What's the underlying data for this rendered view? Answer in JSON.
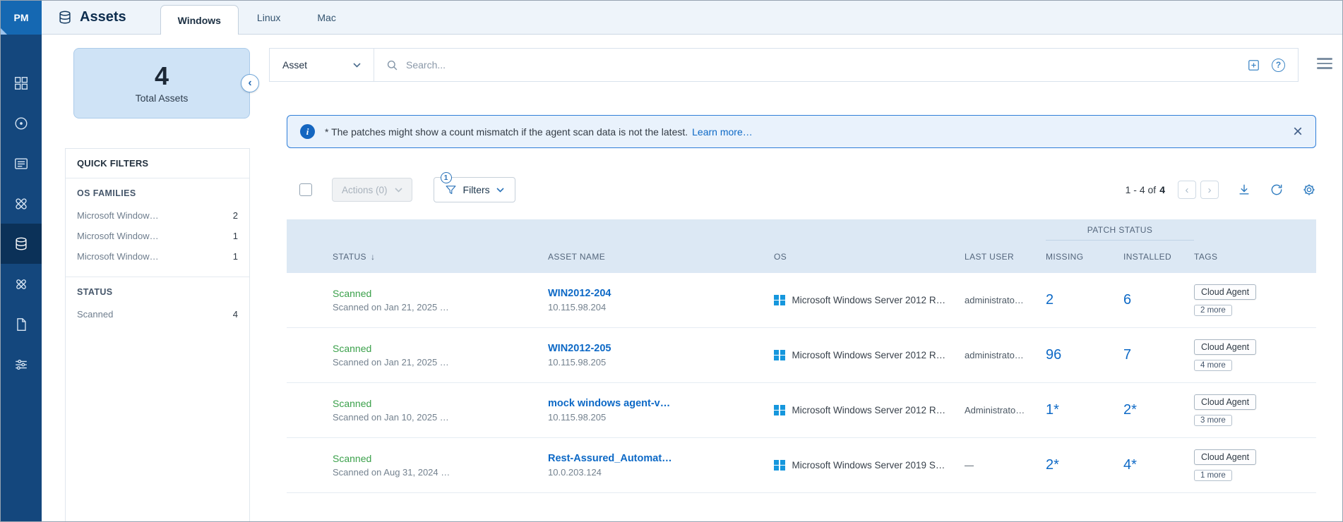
{
  "app": {
    "logo": "PM"
  },
  "colors": {
    "sidebar": "#14477D",
    "accent_link": "#0D69C6",
    "scanned_green": "#3AA04A",
    "banner_border": "#2F7ED8",
    "windows_blue": "#1697DD",
    "table_header_bg": "#DCE8F4",
    "summary_card_bg": "#CFE3F6"
  },
  "sidebar": {
    "icons": [
      "dashboard",
      "scans",
      "catalog",
      "patches",
      "assets",
      "jobs",
      "reports",
      "configuration"
    ],
    "active": "assets"
  },
  "header": {
    "title": "Assets",
    "tabs": [
      {
        "label": "Windows",
        "active": true
      },
      {
        "label": "Linux",
        "active": false
      },
      {
        "label": "Mac",
        "active": false
      }
    ]
  },
  "summary": {
    "value": "4",
    "label": "Total Assets"
  },
  "filters_panel": {
    "title": "QUICK FILTERS",
    "os_families": {
      "title": "OS FAMILIES",
      "items": [
        {
          "label": "Microsoft Window…",
          "count": "2"
        },
        {
          "label": "Microsoft Window…",
          "count": "1"
        },
        {
          "label": "Microsoft Window…",
          "count": "1"
        }
      ]
    },
    "status": {
      "title": "STATUS",
      "items": [
        {
          "label": "Scanned",
          "count": "4"
        }
      ]
    }
  },
  "search": {
    "entity": "Asset",
    "placeholder": "Search...",
    "value": ""
  },
  "banner": {
    "text": "* The patches might show a count mismatch if the agent scan data is not the latest.",
    "link_label": "Learn more…"
  },
  "toolbar": {
    "actions_label": "Actions (0)",
    "filters_label": "Filters",
    "filters_badge": "1",
    "pagination_range": "1 - 4 of",
    "pagination_total": "4"
  },
  "table": {
    "patch_status_group": "PATCH STATUS",
    "columns": {
      "status": "STATUS",
      "asset_name": "ASSET NAME",
      "os": "OS",
      "last_user": "LAST USER",
      "missing": "MISSING",
      "installed": "INSTALLED",
      "tags": "TAGS"
    },
    "rows": [
      {
        "status": "Scanned",
        "status_detail": "Scanned on Jan 21, 2025 …",
        "asset_name": "WIN2012-204",
        "ip": "10.115.98.204",
        "os": "Microsoft Windows Server 2012 R…",
        "last_user": "administrato…",
        "missing": "2",
        "installed": "6",
        "tag": "Cloud Agent",
        "more_tags": "2 more"
      },
      {
        "status": "Scanned",
        "status_detail": "Scanned on Jan 21, 2025 …",
        "asset_name": "WIN2012-205",
        "ip": "10.115.98.205",
        "os": "Microsoft Windows Server 2012 R…",
        "last_user": "administrato…",
        "missing": "96",
        "installed": "7",
        "tag": "Cloud Agent",
        "more_tags": "4 more"
      },
      {
        "status": "Scanned",
        "status_detail": "Scanned on Jan 10, 2025 …",
        "asset_name": "mock windows agent-v…",
        "ip": "10.115.98.205",
        "os": "Microsoft Windows Server 2012 R…",
        "last_user": "Administrato…",
        "missing": "1*",
        "installed": "2*",
        "tag": "Cloud Agent",
        "more_tags": "3 more"
      },
      {
        "status": "Scanned",
        "status_detail": "Scanned on Aug 31, 2024 …",
        "asset_name": "Rest-Assured_Automat…",
        "ip": "10.0.203.124",
        "os": "Microsoft Windows Server 2019 S…",
        "last_user": "—",
        "missing": "2*",
        "installed": "4*",
        "tag": "Cloud Agent",
        "more_tags": "1 more"
      }
    ]
  },
  "icons": {
    "sort_desc": "↓",
    "close": "×",
    "collapse": "‹",
    "prev": "‹",
    "next": "›",
    "info": "i",
    "help": "?"
  }
}
